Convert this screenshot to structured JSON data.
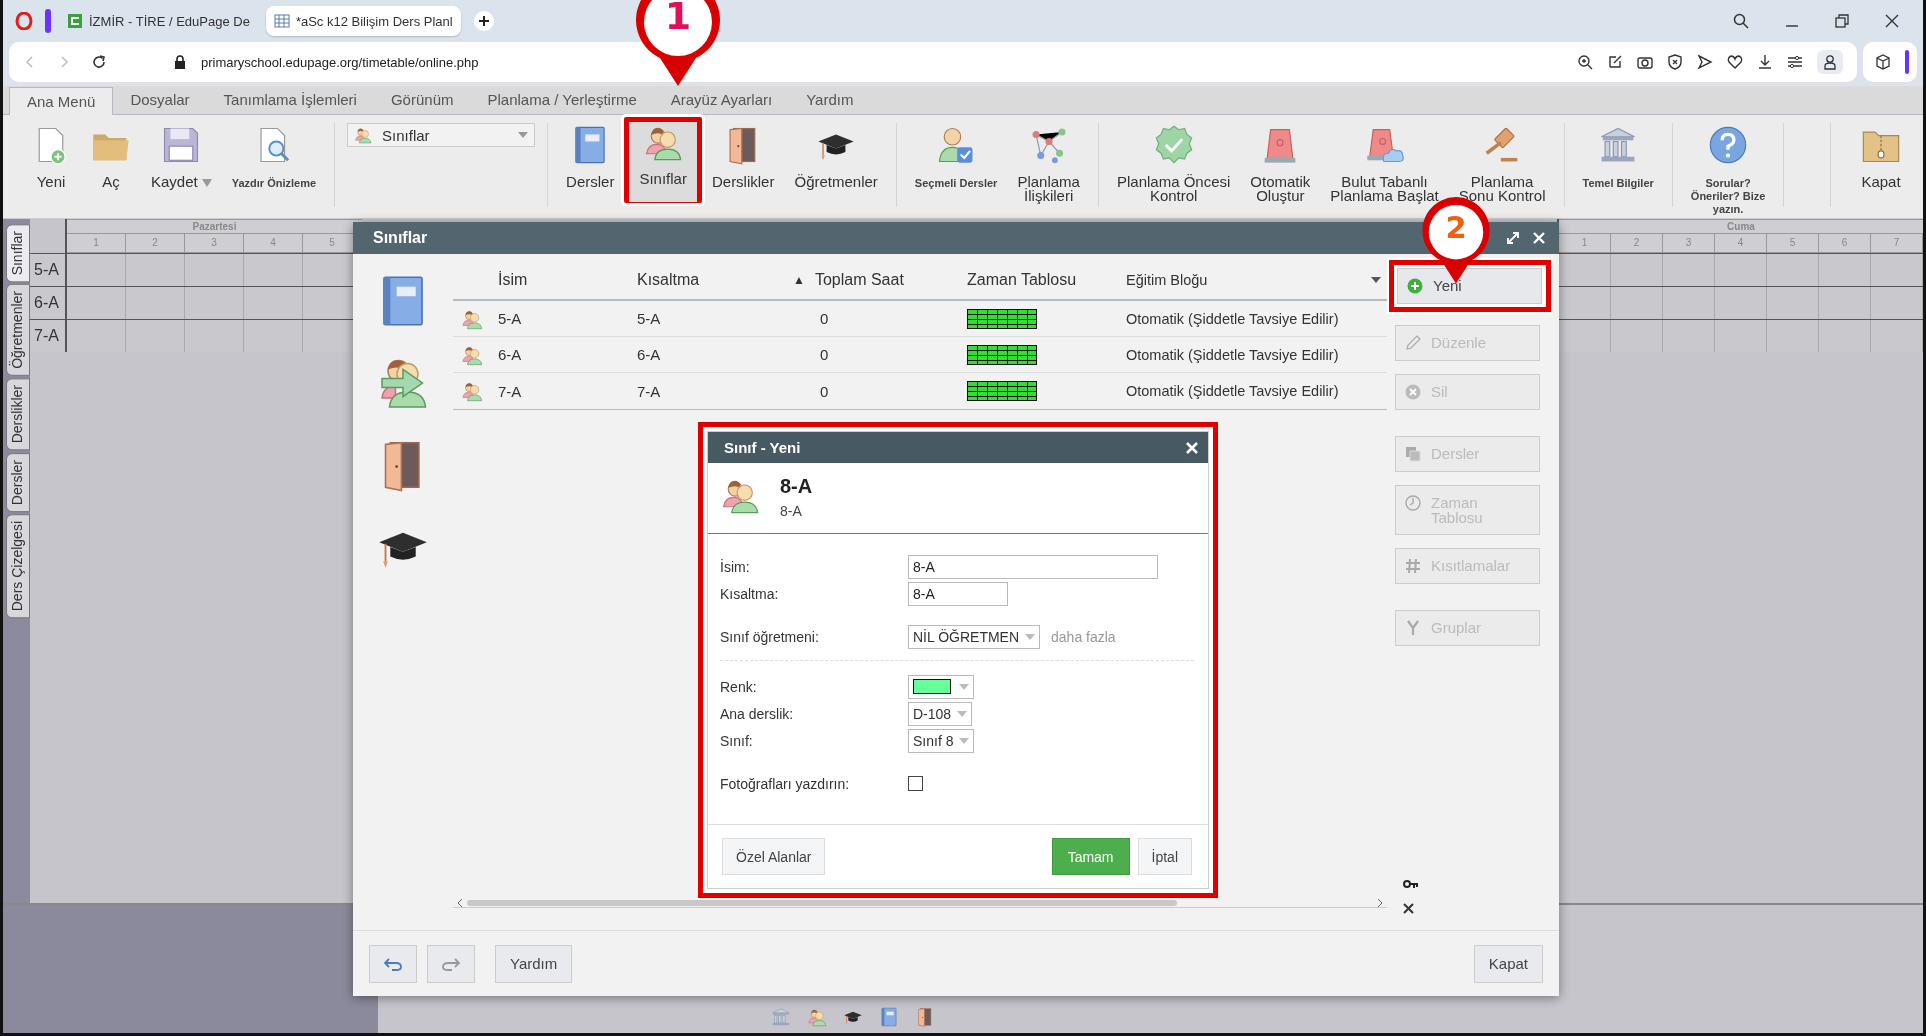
{
  "browser": {
    "tabs": [
      {
        "title": "İZMİR - TİRE / EduPage De",
        "selected": false
      },
      {
        "title": "*aSc k12 Bilişim Ders Planl",
        "selected": true
      }
    ],
    "url": "primaryschool.edupage.org/timetable/online.php"
  },
  "menu": [
    {
      "label": "Ana Menü",
      "selected": true
    },
    {
      "label": "Dosyalar",
      "selected": false
    },
    {
      "label": "Tanımlama İşlemleri",
      "selected": false
    },
    {
      "label": "Görünüm",
      "selected": false
    },
    {
      "label": "Planlama / Yerleştirme",
      "selected": false
    },
    {
      "label": "Arayüz Ayarları",
      "selected": false
    },
    {
      "label": "Yardım",
      "selected": false
    }
  ],
  "toolbar": [
    {
      "kind": "buttons",
      "items": [
        {
          "label": "Yeni",
          "kind": "large",
          "highlighted": false
        },
        {
          "label": "Aç",
          "kind": "large",
          "highlighted": false
        },
        {
          "label": "Kaydet",
          "kind": "split",
          "highlighted": false
        },
        {
          "label": "Yazdır Önizleme",
          "kind": "small",
          "highlighted": false
        }
      ]
    },
    {
      "kind": "dropdown",
      "value": "Sınıflar"
    },
    {
      "kind": "buttons",
      "items": [
        {
          "label": "Dersler",
          "kind": "large",
          "highlighted": false
        },
        {
          "label": "Sınıflar",
          "kind": "large",
          "highlighted": true
        },
        {
          "label": "Derslikler",
          "kind": "large",
          "highlighted": false
        },
        {
          "label": "Öğretmenler",
          "kind": "large",
          "highlighted": false
        }
      ]
    },
    {
      "kind": "buttons",
      "items": [
        {
          "label": "Seçmeli Dersler",
          "kind": "small",
          "highlighted": false
        },
        {
          "label": "Planlama\nİlişkileri",
          "kind": "large",
          "highlighted": false
        }
      ]
    },
    {
      "kind": "buttons",
      "items": [
        {
          "label": "Planlama Öncesi\nKontrol",
          "kind": "large",
          "highlighted": false
        },
        {
          "label": "Otomatik\nOluştur",
          "kind": "large",
          "highlighted": false
        },
        {
          "label": "Bulut Tabanlı\nPlanlama Başlat",
          "kind": "large",
          "highlighted": false
        },
        {
          "label": "Planlama\nSonu Kontrol",
          "kind": "large",
          "highlighted": false
        }
      ]
    },
    {
      "kind": "buttons",
      "items": [
        {
          "label": "Temel Bilgiler",
          "kind": "small",
          "highlighted": false
        }
      ]
    },
    {
      "kind": "buttons",
      "items": [
        {
          "label": "Sorular?\nÖneriler? Bize\nyazın.",
          "kind": "small",
          "highlighted": false
        }
      ]
    },
    {
      "kind": "buttons",
      "items": [
        {
          "label": "Kapat",
          "kind": "large",
          "highlighted": false
        }
      ]
    }
  ],
  "annotations": [
    {
      "label": "1"
    },
    {
      "label": "2"
    }
  ],
  "timetable": {
    "tabs": [
      {
        "label": "Sınıflar",
        "selected": true
      },
      {
        "label": "Öğretmenler",
        "selected": false
      },
      {
        "label": "Derslikler",
        "selected": false
      },
      {
        "label": "Dersler",
        "selected": false
      },
      {
        "label": "Ders Çizelgesi",
        "selected": false
      }
    ],
    "days": [
      {
        "name": "Pazartesi",
        "periods": [
          "1",
          "2",
          "3",
          "4",
          "5"
        ]
      },
      {
        "name": "Cuma",
        "periods": [
          "1",
          "2",
          "3",
          "4",
          "5",
          "6",
          "7"
        ]
      }
    ],
    "rows": [
      "5-A",
      "6-A",
      "7-A"
    ]
  },
  "dialog": {
    "title": "Sınıflar",
    "columns": [
      {
        "label": "İsim"
      },
      {
        "label": "Kısaltma"
      },
      {
        "label": "Toplam Saat",
        "sort_mark": "▲"
      },
      {
        "label": "Zaman Tablosu"
      },
      {
        "label": "Eğitim Bloğu"
      }
    ],
    "rows": [
      {
        "name": "5-A",
        "short": "5-A",
        "hours": "0",
        "block": "Otomatik (Şiddetle Tavsiye Edilir)"
      },
      {
        "name": "6-A",
        "short": "6-A",
        "hours": "0",
        "block": "Otomatik (Şiddetle Tavsiye Edilir)"
      },
      {
        "name": "7-A",
        "short": "7-A",
        "hours": "0",
        "block": "Otomatik (Şiddetle Tavsiye Edilir)"
      }
    ],
    "actions": [
      [
        {
          "label": "Yeni",
          "disabled": false,
          "highlighted": true
        },
        {
          "label": "Düzenle",
          "disabled": true,
          "highlighted": false
        },
        {
          "label": "Sil",
          "disabled": true,
          "highlighted": false
        }
      ],
      [
        {
          "label": "Dersler",
          "disabled": true,
          "highlighted": false
        },
        {
          "label": "Zaman\nTablosu",
          "disabled": true,
          "highlighted": false
        },
        {
          "label": "Kısıtlamalar",
          "disabled": true,
          "highlighted": false
        }
      ],
      [
        {
          "label": "Gruplar",
          "disabled": true,
          "highlighted": false
        }
      ]
    ],
    "footer": {
      "help": "Yardım",
      "close": "Kapat"
    }
  },
  "editor": {
    "title": "Sınıf - Yeni",
    "heading": "8-A",
    "subheading": "8-A",
    "highlighted": true,
    "sections": [
      {
        "rule_above": false,
        "fields": [
          {
            "kind": "text",
            "label": "İsim:",
            "value": "8-A"
          },
          {
            "kind": "short",
            "label": "Kısaltma:",
            "value": "8-A"
          }
        ]
      },
      {
        "rule_above": false,
        "fields": [
          {
            "kind": "select",
            "label": "Sınıf öğretmeni:",
            "value": "NİL ÖĞRETMEN",
            "link": "daha fazla"
          }
        ]
      },
      {
        "rule_above": true,
        "fields": [
          {
            "kind": "color",
            "label": "Renk:",
            "color": "#66ff99"
          },
          {
            "kind": "select",
            "label": "Ana derslik:",
            "value": "D-108"
          },
          {
            "kind": "select",
            "label": "Sınıf:",
            "value": "Sınıf 8"
          }
        ]
      },
      {
        "rule_above": false,
        "fields": [
          {
            "kind": "checkbox",
            "label": "Fotoğrafları yazdırın:",
            "checked": false
          }
        ]
      }
    ],
    "buttons": [
      {
        "label": "Özel Alanlar",
        "kind": "secondary"
      },
      {
        "label": "Tamam",
        "kind": "primary"
      },
      {
        "label": "İptal",
        "kind": "default"
      }
    ]
  }
}
